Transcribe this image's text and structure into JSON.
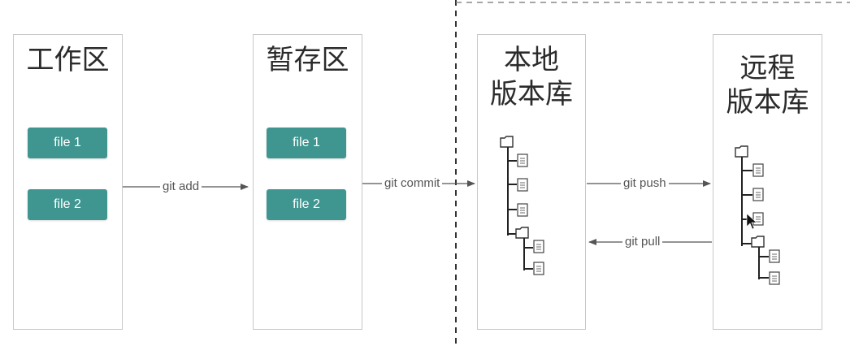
{
  "areas": {
    "workspace": {
      "title": "工作区",
      "files": [
        "file 1",
        "file 2"
      ]
    },
    "staging": {
      "title": "暂存区",
      "files": [
        "file 1",
        "file 2"
      ]
    },
    "local_repo": {
      "title_line1": "本地",
      "title_line2": "版本库"
    },
    "remote_repo": {
      "title_line1": "远程",
      "title_line2": "版本库"
    }
  },
  "commands": {
    "add": "git add",
    "commit": "git commit",
    "push": "git push",
    "pull": "git pull"
  },
  "colors": {
    "file_button": "#3f9690",
    "border": "#c8c8c8",
    "arrow": "#555555"
  },
  "icons": {
    "folder": "folder-icon",
    "file": "document-icon"
  }
}
